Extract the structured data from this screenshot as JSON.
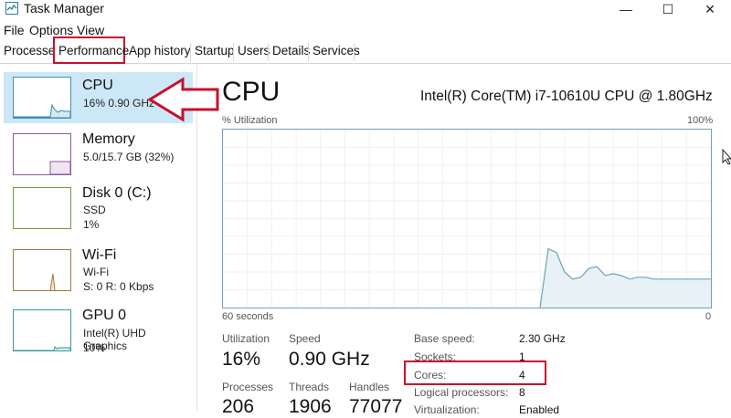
{
  "window": {
    "title": "Task Manager",
    "controls": [
      "—",
      "☐",
      "✕"
    ]
  },
  "menu": [
    "File",
    "Options",
    "View"
  ],
  "tabs": [
    "Processes",
    "Performance",
    "App history",
    "Startup",
    "Users",
    "Details",
    "Services"
  ],
  "active_tab": "Performance",
  "sidebar": {
    "items": [
      {
        "title": "CPU",
        "sub1": "16%  0.90 GHz",
        "sub2": "",
        "selected": true
      },
      {
        "title": "Memory",
        "sub1": "5.0/15.7 GB (32%)",
        "sub2": "",
        "selected": false
      },
      {
        "title": "Disk 0 (C:)",
        "sub1": "SSD",
        "sub2": "1%",
        "selected": false
      },
      {
        "title": "Wi-Fi",
        "sub1": "Wi-Fi",
        "sub2": "S: 0  R: 0 Kbps",
        "selected": false
      },
      {
        "title": "GPU 0",
        "sub1": "Intel(R) UHD Graphics",
        "sub2": "10%",
        "selected": false
      }
    ]
  },
  "main": {
    "heading": "CPU",
    "model": "Intel(R) Core(TM) i7-10610U CPU @ 1.80GHz",
    "graph_label_left": "% Utilization",
    "graph_label_right": "100%",
    "graph_bottom_left": "60 seconds",
    "graph_bottom_right": "0",
    "graph_utilization_series": [
      0,
      0,
      0,
      0,
      0,
      0,
      0,
      0,
      0,
      0,
      0,
      0,
      0,
      0,
      0,
      0,
      0,
      0,
      0,
      0,
      0,
      0,
      0,
      0,
      0,
      0,
      0,
      0,
      0,
      0,
      0,
      0,
      0,
      0,
      0,
      0,
      0,
      0,
      0,
      0,
      33,
      31,
      20,
      16,
      17,
      22,
      23,
      18,
      19,
      18,
      16,
      17,
      17,
      16,
      16,
      16,
      16,
      16,
      16,
      16,
      16
    ],
    "stats": {
      "utilization_label": "Utilization",
      "utilization": "16%",
      "speed_label": "Speed",
      "speed": "0.90 GHz",
      "processes_label": "Processes",
      "processes": "206",
      "threads_label": "Threads",
      "threads": "1906",
      "handles_label": "Handles",
      "handles": "77077"
    },
    "specs": [
      {
        "label": "Base speed:",
        "value": "2.30 GHz"
      },
      {
        "label": "Sockets:",
        "value": "1"
      },
      {
        "label": "Cores:",
        "value": "4"
      },
      {
        "label": "Logical processors:",
        "value": "8"
      },
      {
        "label": "Virtualization:",
        "value": "Enabled"
      }
    ]
  },
  "colors": {
    "selection": "#cce8f7",
    "graph_border": "#6da3b8",
    "graph_fill": "#e8f1f5",
    "annotation": "#c8102e"
  }
}
